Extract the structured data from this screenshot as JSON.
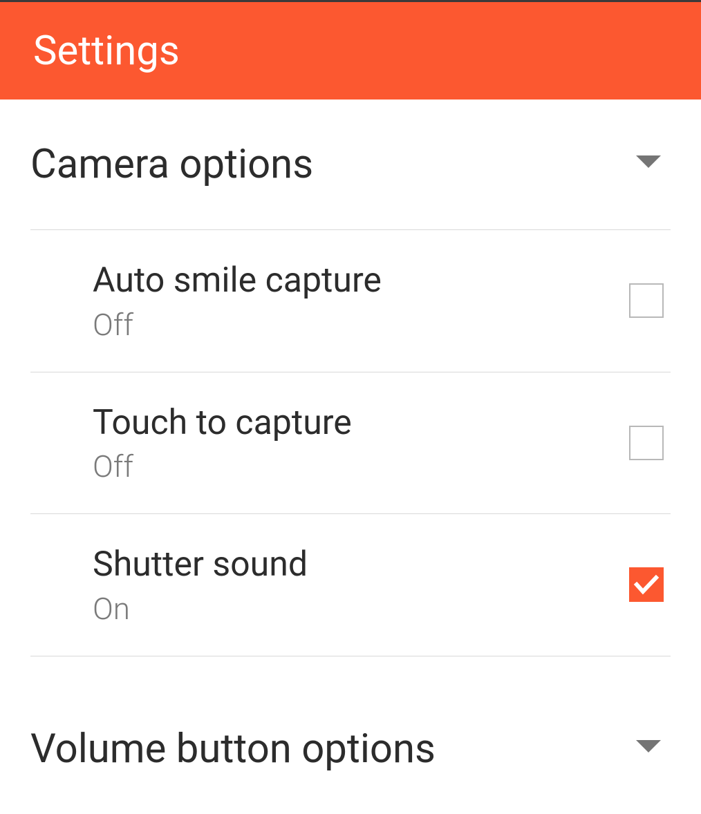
{
  "header": {
    "title": "Settings"
  },
  "sections": [
    {
      "title": "Camera options",
      "options": [
        {
          "title": "Auto smile capture",
          "status": "Off",
          "checked": false
        },
        {
          "title": "Touch to capture",
          "status": "Off",
          "checked": false
        },
        {
          "title": "Shutter sound",
          "status": "On",
          "checked": true
        }
      ]
    },
    {
      "title": "Volume button options"
    }
  ],
  "colors": {
    "accent": "#fc5830"
  }
}
